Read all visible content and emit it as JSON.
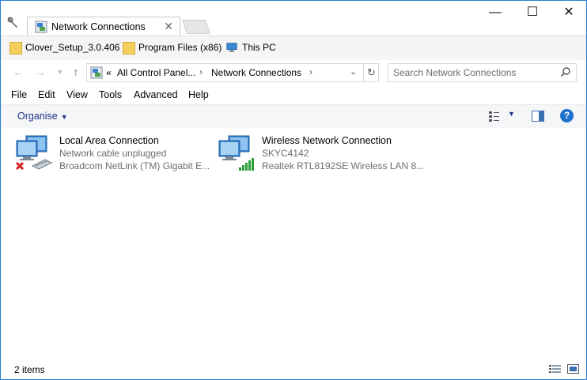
{
  "tab": {
    "title": "Network Connections",
    "close_glyph": "✕"
  },
  "window_controls": {
    "minimize": "—",
    "maximize": "☐",
    "close": "✕"
  },
  "favorites": [
    {
      "label": "Clover_Setup_3.0.406",
      "icon": "folder-icon"
    },
    {
      "label": "Program Files (x86)",
      "icon": "folder-icon"
    },
    {
      "label": "This PC",
      "icon": "computer-icon"
    }
  ],
  "address": {
    "overflow": "«",
    "crumbs": [
      "All Control Panel...",
      "Network Connections"
    ]
  },
  "search": {
    "placeholder": "Search Network Connections"
  },
  "menu": [
    "File",
    "Edit",
    "View",
    "Tools",
    "Advanced",
    "Help"
  ],
  "toolbar": {
    "organise": "Organise"
  },
  "connections": [
    {
      "name": "Local Area Connection",
      "status": "Network cable unplugged",
      "device": "Broadcom NetLink (TM) Gigabit E...",
      "icon": "ethernet-disconnected-icon"
    },
    {
      "name": "Wireless Network Connection",
      "status": "SKYC4142",
      "device": "Realtek RTL8192SE Wireless LAN 8...",
      "icon": "wireless-connected-icon"
    }
  ],
  "statusbar": {
    "item_count": "2 items"
  },
  "colors": {
    "accent": "#1e70cd",
    "link": "#1e3287",
    "border": "#2b7bd6"
  }
}
